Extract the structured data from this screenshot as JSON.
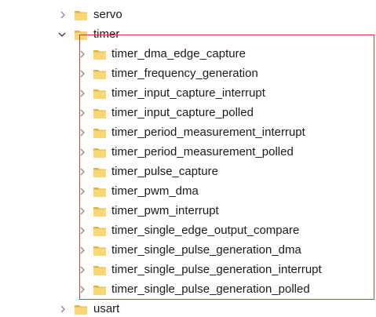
{
  "tree": {
    "top_items": [
      {
        "label": "servo",
        "state": "collapsed"
      },
      {
        "label": "timer",
        "state": "expanded"
      }
    ],
    "children": [
      {
        "label": "timer_dma_edge_capture"
      },
      {
        "label": "timer_frequency_generation"
      },
      {
        "label": "timer_input_capture_interrupt"
      },
      {
        "label": "timer_input_capture_polled"
      },
      {
        "label": "timer_period_measurement_interrupt"
      },
      {
        "label": "timer_period_measurement_polled"
      },
      {
        "label": "timer_pulse_capture"
      },
      {
        "label": "timer_pwm_dma"
      },
      {
        "label": "timer_pwm_interrupt"
      },
      {
        "label": "timer_single_edge_output_compare"
      },
      {
        "label": "timer_single_pulse_generation_dma"
      },
      {
        "label": "timer_single_pulse_generation_interrupt"
      },
      {
        "label": "timer_single_pulse_generation_polled"
      }
    ],
    "bottom_items": [
      {
        "label": "usart",
        "state": "collapsed"
      }
    ]
  },
  "colors": {
    "folder_yellow": "#f8d775",
    "folder_dark": "#e0b440",
    "chevron": "#8a8a8a",
    "highlight_box": "#d9363e"
  },
  "icons": {
    "folder": "folder-icon",
    "collapsed": "chevron-right-icon",
    "expanded": "chevron-down-icon"
  }
}
